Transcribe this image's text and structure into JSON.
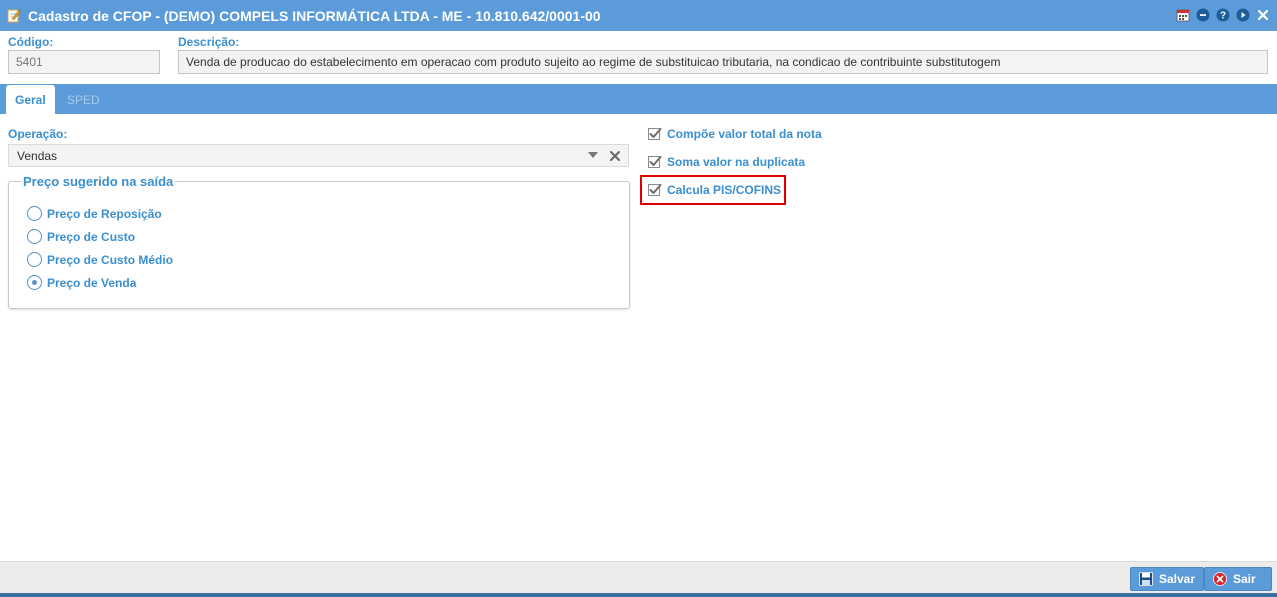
{
  "window": {
    "title": "Cadastro de CFOP - (DEMO) COMPELS INFORMÁTICA LTDA - ME - 10.810.642/0001-00",
    "title_icon": "edit-icon",
    "toolbar_icons": [
      "calendar-icon",
      "minimize-icon",
      "help-icon",
      "forward-icon",
      "close-icon"
    ]
  },
  "header": {
    "codigo_label": "Código:",
    "codigo_value": "5401",
    "descricao_label": "Descrição:",
    "descricao_value": "Venda de producao do estabelecimento em operacao com produto sujeito ao regime de substituicao tributaria, na condicao de contribuinte substitutogem"
  },
  "tabs": [
    {
      "label": "Geral",
      "active": true
    },
    {
      "label": "SPED",
      "active": false
    }
  ],
  "geral": {
    "operacao_label": "Operação:",
    "operacao_value": "Vendas",
    "preco_group_title": "Preço sugerido na saída",
    "preco_options": [
      {
        "label": "Preço de Reposição",
        "checked": false
      },
      {
        "label": "Preço de Custo",
        "checked": false
      },
      {
        "label": "Preço de Custo Médio",
        "checked": false
      },
      {
        "label": "Preço de Venda",
        "checked": true
      }
    ],
    "checks": [
      {
        "label": "Compõe valor total da nota",
        "checked": true
      },
      {
        "label": "Soma valor na duplicata",
        "checked": true
      },
      {
        "label": "Calcula PIS/COFINS",
        "checked": true
      }
    ]
  },
  "footer": {
    "save_label": "Salvar",
    "exit_label": "Sair"
  },
  "colors": {
    "accent": "#5b9bd9",
    "label": "#3a8fd1",
    "highlight": "#e00000"
  }
}
